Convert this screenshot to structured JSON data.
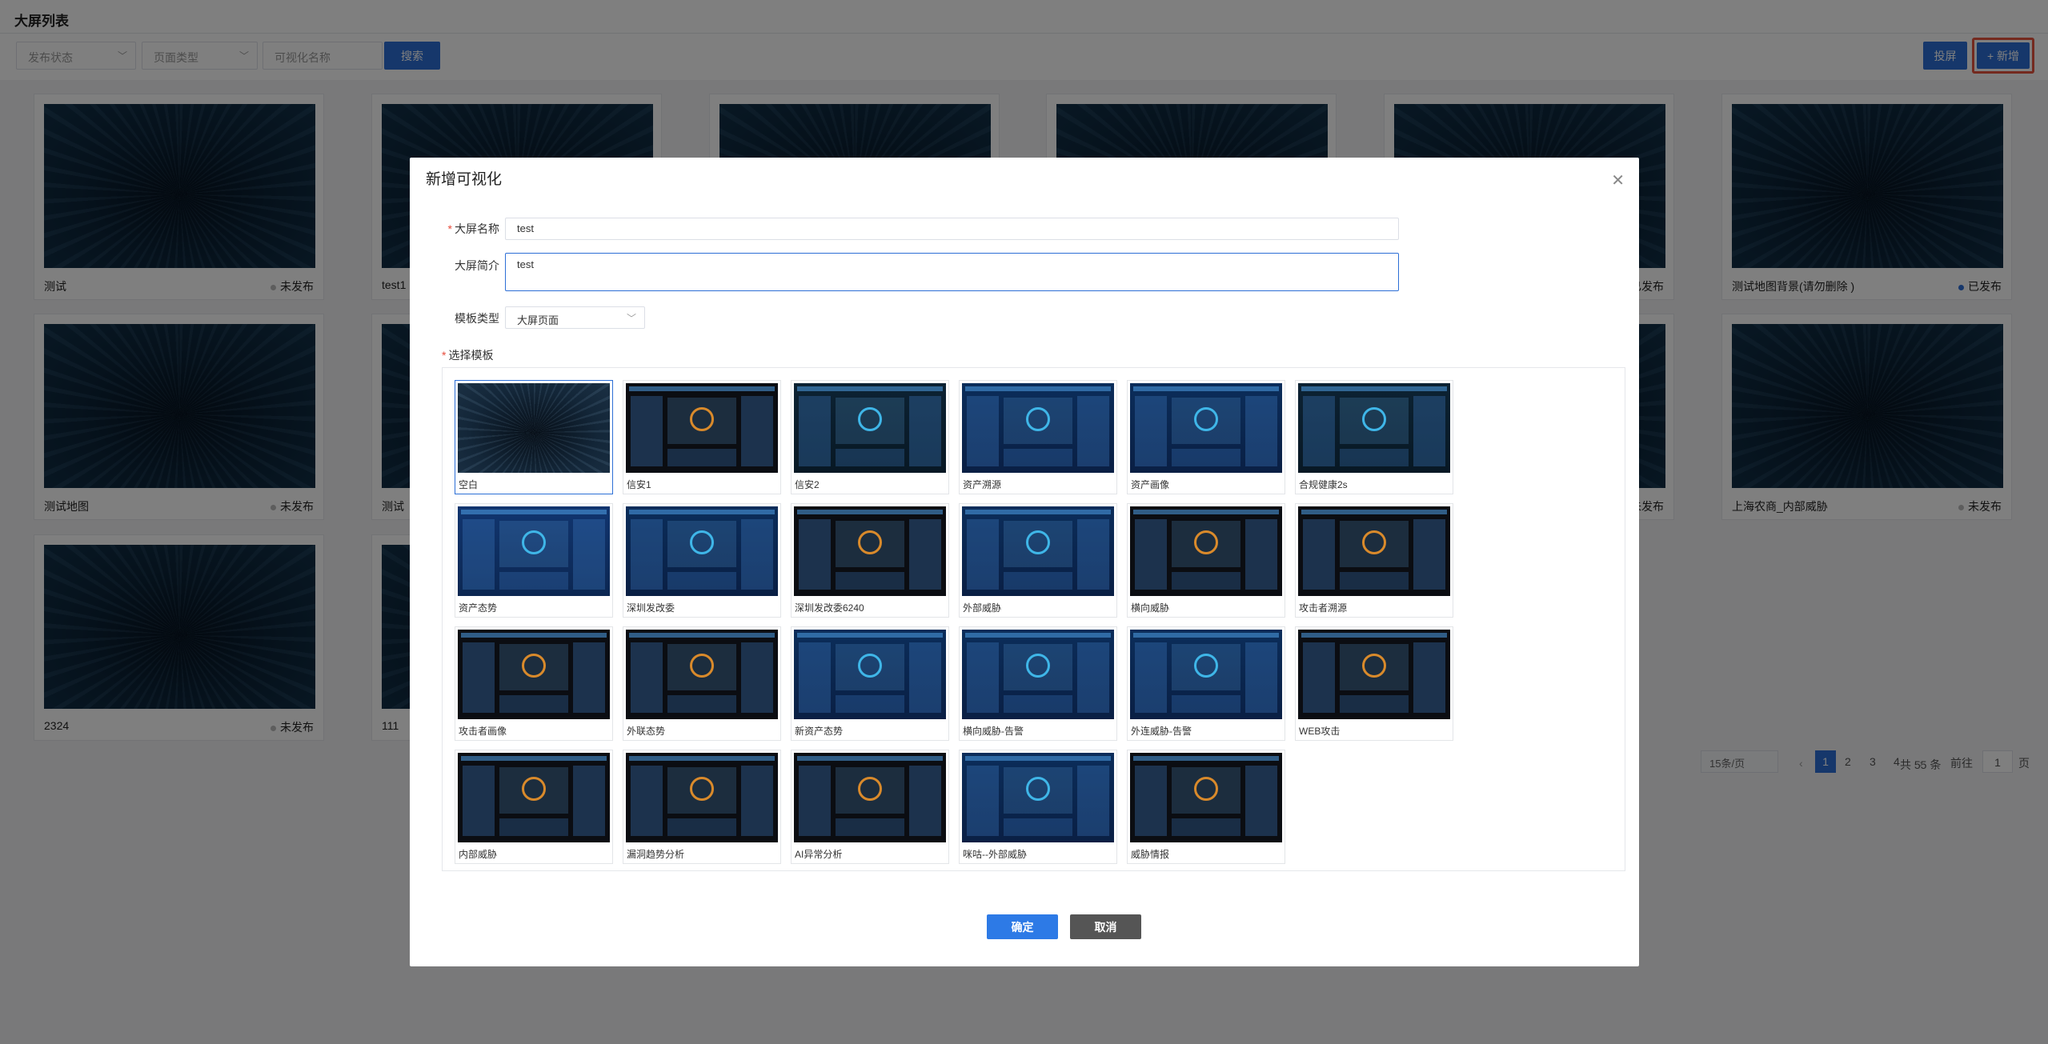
{
  "page": {
    "title": "大屏列表"
  },
  "filters": {
    "status_placeholder": "发布状态",
    "type_placeholder": "页面类型",
    "name_placeholder": "可视化名称",
    "search_label": "搜索"
  },
  "toolbar": {
    "cast_label": "投屏",
    "add_label": "+ 新增"
  },
  "cards": [
    {
      "name": "测试",
      "status": "未发布"
    },
    {
      "name": "test1",
      "status": ""
    },
    {
      "name": "",
      "status": ""
    },
    {
      "name": "",
      "status": ""
    },
    {
      "name": "",
      "status": "已发布"
    },
    {
      "name": "测试地图背景(请勿删除 )",
      "status": "已发布"
    },
    {
      "name": "测试地图",
      "status": "未发布"
    },
    {
      "name": "测试",
      "status": ""
    },
    {
      "name": "",
      "status": ""
    },
    {
      "name": "",
      "status": ""
    },
    {
      "name": "",
      "status": "未发布"
    },
    {
      "name": "上海农商_内部威胁",
      "status": "未发布"
    },
    {
      "name": "2324",
      "status": "未发布"
    },
    {
      "name": "111",
      "status": ""
    }
  ],
  "pagination": {
    "total": "共 55 条",
    "page_size": "15条/页",
    "prev": "‹",
    "pages": [
      "1",
      "2",
      "3",
      "4"
    ],
    "next": "›",
    "goto_label": "前往",
    "goto_value": "1",
    "page_suffix": "页"
  },
  "modal": {
    "title": "新增可视化",
    "close_icon": "close-icon",
    "name_label": "大屏名称",
    "name_value": "test",
    "desc_label": "大屏简介",
    "desc_value": "test",
    "type_label": "模板类型",
    "type_value": "大屏页面",
    "select_label": "选择模板",
    "required_mark": "*",
    "ok_label": "确定",
    "cancel_label": "取消",
    "templates": [
      {
        "name": "空白",
        "theme": "dark"
      },
      {
        "name": "信安1",
        "theme": "black"
      },
      {
        "name": "信安2",
        "theme": "teal"
      },
      {
        "name": "资产溯源",
        "theme": "navy"
      },
      {
        "name": "资产画像",
        "theme": "navy"
      },
      {
        "name": "合规健康2s",
        "theme": "teal"
      },
      {
        "name": "资产态势",
        "theme": "blue"
      },
      {
        "name": "深圳发改委",
        "theme": "navy"
      },
      {
        "name": "深圳发改委6240",
        "theme": "black"
      },
      {
        "name": "外部威胁",
        "theme": "navy"
      },
      {
        "name": "横向威胁",
        "theme": "black"
      },
      {
        "name": "攻击者溯源",
        "theme": "black"
      },
      {
        "name": "攻击者画像",
        "theme": "black"
      },
      {
        "name": "外联态势",
        "theme": "black"
      },
      {
        "name": "新资产态势",
        "theme": "navy"
      },
      {
        "name": "横向威胁-告警",
        "theme": "navy"
      },
      {
        "name": "外连威胁-告警",
        "theme": "navy"
      },
      {
        "name": "WEB攻击",
        "theme": "black"
      },
      {
        "name": "内部威胁",
        "theme": "black"
      },
      {
        "name": "漏洞趋势分析",
        "theme": "black"
      },
      {
        "name": "AI异常分析",
        "theme": "black"
      },
      {
        "name": "咪咕--外部威胁",
        "theme": "navy"
      },
      {
        "name": "威胁情报",
        "theme": "black"
      }
    ]
  }
}
